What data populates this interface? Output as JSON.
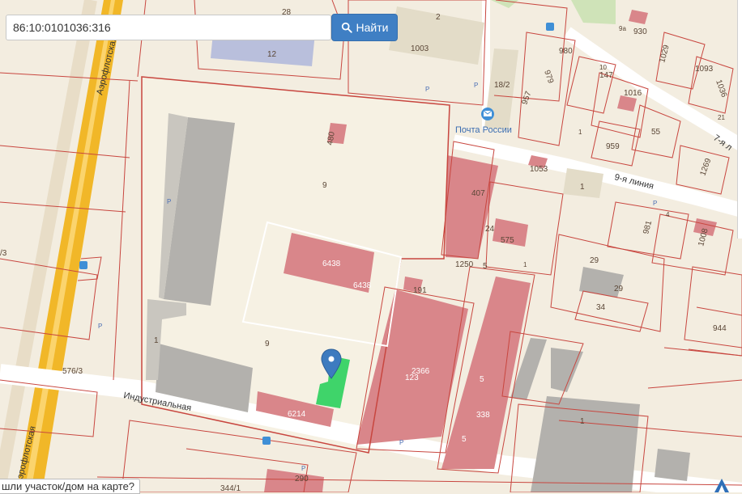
{
  "search": {
    "value": "86:10:0101036:316"
  },
  "search_button": {
    "label": "Найти",
    "icon": "search-icon"
  },
  "hint": {
    "text": "шли участок/дом на карте?"
  },
  "marker": {
    "icon": "map-pin-icon",
    "color": "#3d7bbf"
  },
  "colors": {
    "background": "#f3ede0",
    "parcel_outline": "#c8463f",
    "building_pink": "#d9868a",
    "building_gray": "#b3b1ad",
    "highlight_green": "#3fd46a",
    "road_yellow": "#f1b728"
  },
  "map": {
    "streets": {
      "aeroflotskaya_top": "Аэрофлотская",
      "aeroflotskaya_bottom": "Аэрофлотская",
      "industrialnaya": "Индустриальная",
      "ninth_line": "9-я линия",
      "seventh_line": "7-я л"
    },
    "poi": {
      "post_office": "Почта России"
    },
    "labels": {
      "l28": "28",
      "l2": "2",
      "l930": "930",
      "l1003": "1003",
      "l12": "12",
      "l980": "980",
      "l979": "979",
      "l18_2": "18/2",
      "l957": "957",
      "l147": "147",
      "l1029": "1029",
      "l1093": "1093",
      "l1036": "1036",
      "l1016": "1016",
      "l55": "55",
      "l959": "959",
      "l1269": "1269",
      "l1053": "1053",
      "l1a": "1",
      "l480": "480",
      "l9a": "9",
      "l407": "407",
      "l24": "24",
      "l575": "575",
      "l981": "981",
      "l1008": "1008",
      "l6438a": "6438",
      "l6438b": "6438",
      "l1250": "1250",
      "l5a": "5",
      "l29a": "29",
      "l29b": "29",
      "l191": "191",
      "l34": "34",
      "l944": "944",
      "l1b": "1",
      "l9b": "9",
      "l576_3": "576/3",
      "l2366": "2366",
      "l123": "123",
      "l5b": "5",
      "l338": "338",
      "l6214": "6214",
      "l1c": "1",
      "l5c": "5",
      "l290": "290",
      "l344_1": "344/1",
      "l3": "/3",
      "l9a_small": "9а",
      "l10": "10",
      "l4": "4",
      "l1d": "1",
      "l1e": "1",
      "l21": "21"
    },
    "parking": "P"
  }
}
